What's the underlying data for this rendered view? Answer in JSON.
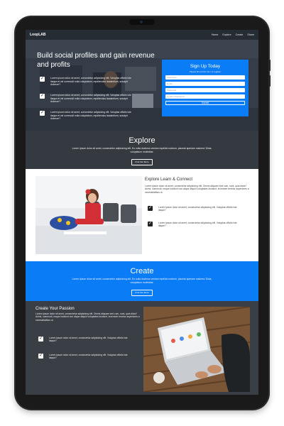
{
  "nav": {
    "brand": "LoopLAB",
    "links": [
      "Home",
      "Explore",
      "Create",
      "Share"
    ]
  },
  "hero": {
    "title": "Build social profiles and gain revenue and profits",
    "items": [
      "Lorem ipsum dolor sit amet, consectetur adipisicing elit. Voluptas officiis iste itaque et vel commodi nulla voluptatum, repellendus laudantium, suscipit dolorum?",
      "Lorem ipsum dolor sit amet, consectetur adipisicing elit. Voluptas officiis iste itaque et vel commodi nulla voluptatum, repellendus laudantium, suscipit dolorum?",
      "Lorem ipsum dolor sit amet, consectetur adipisicing elit. Voluptas officiis iste itaque et vel commodi nulla voluptatum, repellendus laudantium, suscipit dolorum?"
    ]
  },
  "signup": {
    "title": "Sign Up Today",
    "subtitle": "Please fill out this form to register",
    "placeholders": {
      "username": "Username",
      "email": "Email",
      "password": "Password",
      "confirm": "Confirm Password"
    },
    "submit": "Submit"
  },
  "explore": {
    "title": "Explore",
    "text": "Lorem ipsum dolor sit amet, consectetur adipisicing elit. Eo nulla ducimus veniam repellat nostrum, placeat aperiam maiores! Dicta, voluptatum molestiae.",
    "button": "Find Out More"
  },
  "learn": {
    "title": "Explore Learn & Connect",
    "text": "Lorem ipsum dolor sit amet, consectetur adipisicing elit. Omnis aliquam sed cum, sunt, quia dicta? Animi, commodi, neque incidunt non atque aliquid voluptates incidunt, inventore tenetur asperiores a necessitatibus ut.",
    "items": [
      "Lorem ipsum dolor sit amet, consectetur adipisicing elit. Voluptas officiis iste itaque?",
      "Lorem ipsum dolor sit amet, consectetur adipisicing elit. Voluptas officiis iste itaque?"
    ]
  },
  "create": {
    "title": "Create",
    "text": "Lorem ipsum dolor sit amet, consectetur adipisicing elit. Eo nulla ducimus veniam repellat nostrum, placeat aperiam maiores! Dicta, voluptatum molestiae.",
    "button": "Find Out More"
  },
  "passion": {
    "title": "Create Your Passion",
    "text": "Lorem ipsum dolor sit amet, consectetur adipisicing elit. Omnis aliquam sed cum, sunt, quia dicta? Animi, commodi, neque incidunt non atque aliquid voluptates incidunt, inventore tenetur asperiores a necessitatibus ut.",
    "items": [
      "Lorem ipsum dolor sit amet, consectetur adipisicing elit. Voluptas officiis iste itaque?",
      "Lorem ipsum dolor sit amet, consectetur adipisicing elit. Voluptas officiis iste itaque?"
    ]
  },
  "icons": {
    "check": "check-icon"
  },
  "colors": {
    "accent_blue": "#0a7cf5",
    "dark_section": "#343a40"
  }
}
